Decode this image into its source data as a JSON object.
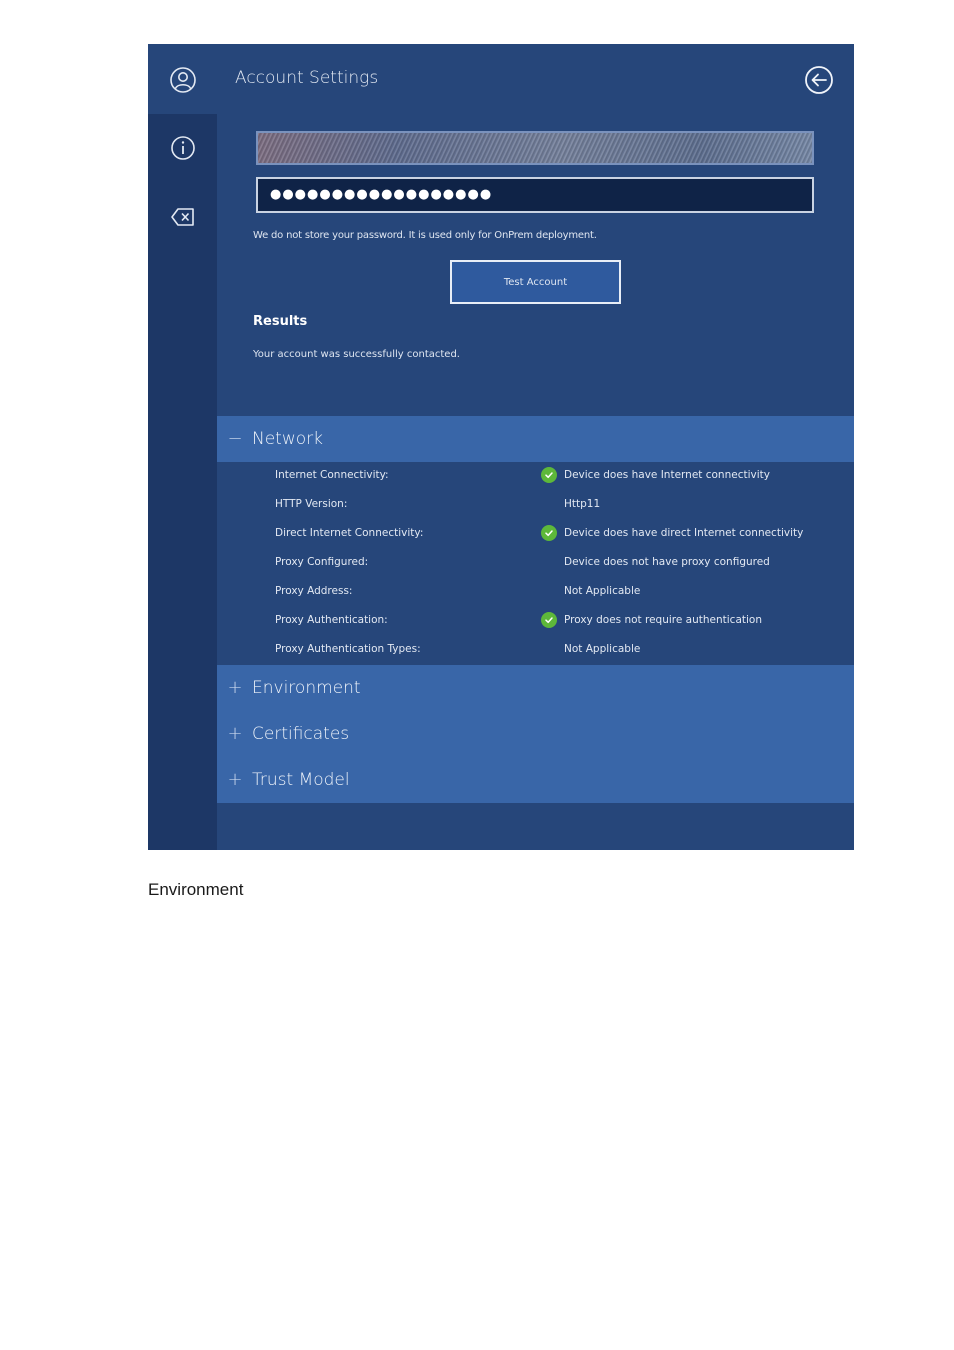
{
  "window": {
    "title": "Account Settings"
  },
  "sidebar": {
    "items": [
      {
        "icon": "account-icon"
      },
      {
        "icon": "info-icon"
      },
      {
        "icon": "clear-icon"
      }
    ]
  },
  "form": {
    "password_value": "●●●●●●●●●●●●●●●●●●",
    "password_note": "We do not store your password. It is used only for OnPrem deployment.",
    "test_button_label": "Test Account"
  },
  "results": {
    "heading": "Results",
    "text": "Your account was successfully contacted."
  },
  "sections": {
    "network": {
      "label": "Network",
      "toggle": "−",
      "rows": [
        {
          "key": "Internet Connectivity:",
          "value": "Device does have Internet connectivity",
          "check": true
        },
        {
          "key": "HTTP Version:",
          "value": "Http11",
          "check": false
        },
        {
          "key": "Direct Internet Connectivity:",
          "value": "Device does have direct Internet connectivity",
          "check": true
        },
        {
          "key": "Proxy Configured:",
          "value": "Device does not have proxy configured",
          "check": false
        },
        {
          "key": "Proxy Address:",
          "value": "Not Applicable",
          "check": false
        },
        {
          "key": "Proxy Authentication:",
          "value": "Proxy does not require authentication",
          "check": true
        },
        {
          "key": "Proxy Authentication Types:",
          "value": "Not Applicable",
          "check": false
        }
      ]
    },
    "environment": {
      "label": "Environment",
      "toggle": "+"
    },
    "certificates": {
      "label": "Certificates",
      "toggle": "+"
    },
    "trust_model": {
      "label": "Trust Model",
      "toggle": "+"
    }
  },
  "caption": "Environment",
  "colors": {
    "panel_bg": "#26467a",
    "sidebar_bg": "#1d3766",
    "section_header_bg": "#3966a8",
    "success_green": "#5db83a"
  }
}
